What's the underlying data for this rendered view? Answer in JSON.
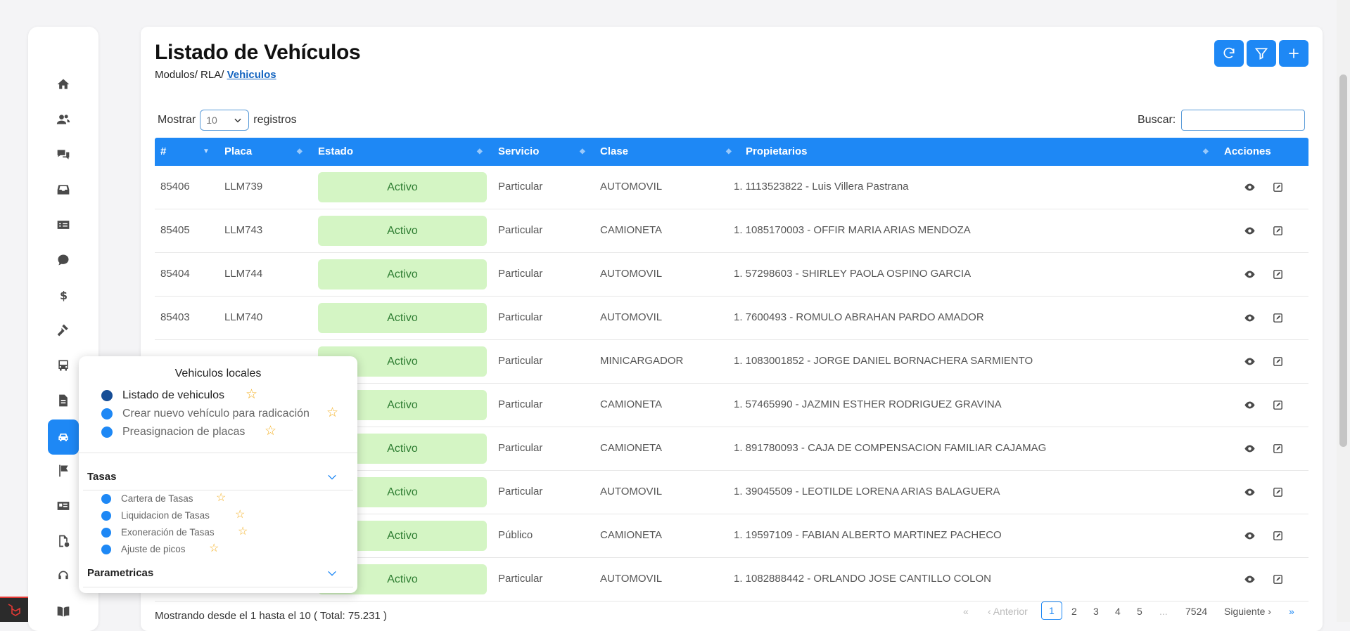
{
  "page": {
    "title": "Listado de Vehículos",
    "breadcrumb": {
      "part1": "Modulos/",
      "part2": "RLA/",
      "current": "Vehiculos"
    }
  },
  "toolbar": {
    "refresh_icon": "refresh-icon",
    "filter_icon": "filter-icon",
    "add_icon": "plus-icon"
  },
  "length_menu": {
    "prefix": "Mostrar",
    "value": "10",
    "suffix": "registros"
  },
  "search": {
    "label": "Buscar:",
    "value": ""
  },
  "table": {
    "headers": [
      "#",
      "Placa",
      "Estado",
      "Servicio",
      "Clase",
      "Propietarios",
      "Acciones"
    ],
    "rows": [
      {
        "id": "85406",
        "placa": "LLM739",
        "estado": "Activo",
        "servicio": "Particular",
        "clase": "AUTOMOVIL",
        "propietarios": "1. 1113523822 - Luis Villera Pastrana"
      },
      {
        "id": "85405",
        "placa": "LLM743",
        "estado": "Activo",
        "servicio": "Particular",
        "clase": "CAMIONETA",
        "propietarios": "1. 1085170003 - OFFIR MARIA ARIAS MENDOZA"
      },
      {
        "id": "85404",
        "placa": "LLM744",
        "estado": "Activo",
        "servicio": "Particular",
        "clase": "AUTOMOVIL",
        "propietarios": "1. 57298603 - SHIRLEY PAOLA OSPINO GARCIA"
      },
      {
        "id": "85403",
        "placa": "LLM740",
        "estado": "Activo",
        "servicio": "Particular",
        "clase": "AUTOMOVIL",
        "propietarios": "1. 7600493 - ROMULO ABRAHAN PARDO AMADOR"
      },
      {
        "id": "",
        "placa": "",
        "estado": "Activo",
        "servicio": "Particular",
        "clase": "MINICARGADOR",
        "propietarios": "1. 1083001852 - JORGE DANIEL BORNACHERA SARMIENTO"
      },
      {
        "id": "",
        "placa": "",
        "estado": "Activo",
        "servicio": "Particular",
        "clase": "CAMIONETA",
        "propietarios": "1. 57465990 - JAZMIN ESTHER RODRIGUEZ GRAVINA"
      },
      {
        "id": "",
        "placa": "",
        "estado": "Activo",
        "servicio": "Particular",
        "clase": "CAMIONETA",
        "propietarios": "1. 891780093 - CAJA DE COMPENSACION FAMILIAR CAJAMAG"
      },
      {
        "id": "",
        "placa": "",
        "estado": "Activo",
        "servicio": "Particular",
        "clase": "AUTOMOVIL",
        "propietarios": "1. 39045509 - LEOTILDE LORENA ARIAS BALAGUERA"
      },
      {
        "id": "",
        "placa": "",
        "estado": "Activo",
        "servicio": "Público",
        "clase": "CAMIONETA",
        "propietarios": "1. 19597109 - FABIAN ALBERTO MARTINEZ PACHECO"
      },
      {
        "id": "",
        "placa": "",
        "estado": "Activo",
        "servicio": "Particular",
        "clase": "AUTOMOVIL",
        "propietarios": "1. 1082888442 - ORLANDO JOSE CANTILLO COLON"
      }
    ]
  },
  "footer": {
    "info": "Mostrando desde el 1 hasta el 10 ( Total: 75.231 )",
    "pagination": {
      "first": "«",
      "prev": "Anterior",
      "pages": [
        "1",
        "2",
        "3",
        "4",
        "5"
      ],
      "ellipsis": "...",
      "last_page": "7524",
      "next": "Siguiente",
      "last": "»"
    }
  },
  "popup": {
    "title": "Vehiculos locales",
    "items": [
      {
        "label": "Listado de vehiculos"
      },
      {
        "label": "Crear nuevo vehículo para radicación"
      },
      {
        "label": "Preasignacion de placas"
      }
    ],
    "sections": [
      {
        "label": "Tasas",
        "items": [
          "Cartera de Tasas",
          "Liquidacion de Tasas",
          "Exoneración de Tasas",
          "Ajuste de picos"
        ]
      },
      {
        "label": "Parametricas"
      }
    ]
  },
  "sidebar": {
    "icons": [
      "home-icon",
      "users-icon",
      "chat-icon",
      "inbox-icon",
      "id-card-icon",
      "comment-icon",
      "dollar-icon",
      "gavel-icon",
      "bus-icon",
      "document-icon",
      "car-icon",
      "flag-icon",
      "license-icon",
      "file-info-icon",
      "headset-icon",
      "book-icon"
    ]
  },
  "colors": {
    "primary": "#1e88f5",
    "active_badge_bg": "#d4f5c4",
    "active_badge_text": "#2e7d32",
    "star": "#f4b32a"
  }
}
